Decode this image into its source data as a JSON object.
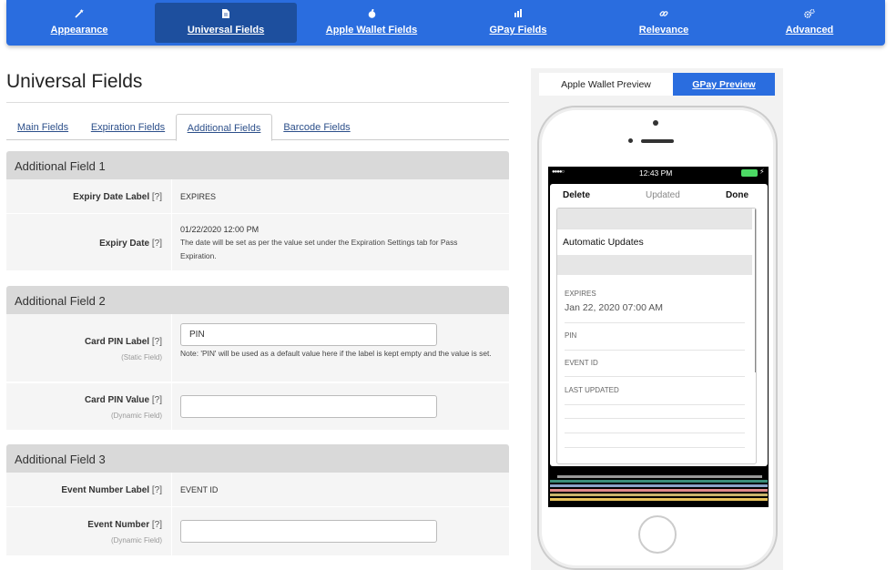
{
  "nav": {
    "items": [
      {
        "label": "Appearance",
        "icon": "magic-wand-icon"
      },
      {
        "label": "Universal Fields",
        "icon": "document-icon"
      },
      {
        "label": "Apple Wallet Fields",
        "icon": "apple-icon"
      },
      {
        "label": "GPay Fields",
        "icon": "gpay-icon"
      },
      {
        "label": "Relevance",
        "icon": "link-icon"
      },
      {
        "label": "Advanced",
        "icon": "gears-icon"
      }
    ],
    "active_index": 1,
    "color": "#2a6ddf",
    "active_color": "#1d4f9e"
  },
  "page": {
    "title": "Universal Fields",
    "tabs": [
      "Main Fields",
      "Expiration Fields",
      "Additional Fields",
      "Barcode Fields"
    ],
    "active_tab": 2
  },
  "sections": [
    {
      "title": "Additional Field 1",
      "rows": [
        {
          "label": "Expiry Date Label",
          "help": "[?]",
          "value": "EXPIRES"
        },
        {
          "label": "Expiry Date",
          "help": "[?]",
          "value": "01/22/2020 12:00 PM",
          "note": "The date will be set as per the value set under the Expiration Settings tab for Pass Expiration."
        }
      ]
    },
    {
      "title": "Additional Field 2",
      "rows": [
        {
          "label": "Card PIN Label",
          "help": "[?]",
          "sub": "(Static Field)",
          "input_value": "PIN",
          "note": "Note: 'PIN' will be used as a default value here if the label is kept empty and the value is set."
        },
        {
          "label": "Card PIN Value",
          "help": "[?]",
          "sub": "(Dynamic Field)",
          "input_value": ""
        }
      ]
    },
    {
      "title": "Additional Field 3",
      "rows": [
        {
          "label": "Event Number Label",
          "help": "[?]",
          "value": "EVENT ID"
        },
        {
          "label": "Event Number",
          "help": "[?]",
          "sub": "(Dynamic Field)",
          "input_value": ""
        }
      ]
    }
  ],
  "preview": {
    "tabs": [
      "Apple Wallet Preview",
      "GPay Preview"
    ],
    "status": {
      "signal": "●●●●○",
      "time": "12:43 PM"
    },
    "header": {
      "left": "Delete",
      "center": "Updated",
      "right": "Done"
    },
    "auto_updates": "Automatic Updates",
    "fields": [
      {
        "label": "EXPIRES",
        "value": "Jan 22, 2020 07:00 AM"
      },
      {
        "label": "PIN",
        "value": ""
      },
      {
        "label": "EVENT ID",
        "value": ""
      },
      {
        "label": "LAST UPDATED",
        "value": ""
      }
    ],
    "battery_color": "#4cd964"
  }
}
